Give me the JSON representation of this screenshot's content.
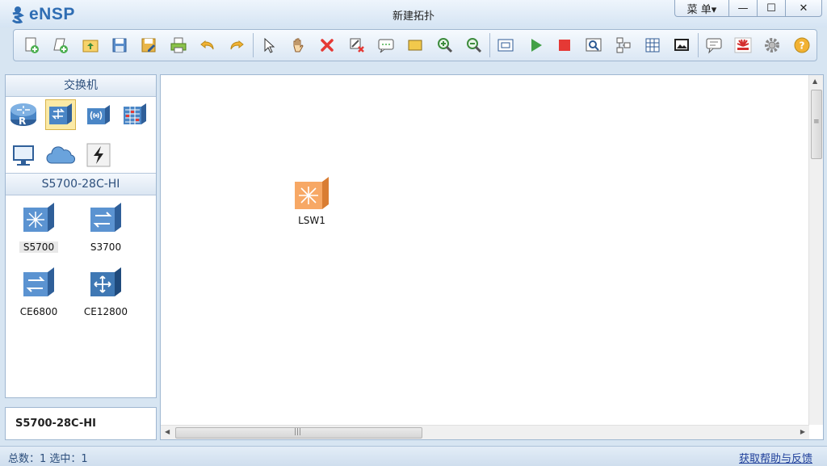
{
  "app": {
    "name": "eNSP",
    "window_title": "新建拓扑"
  },
  "window_controls": {
    "menu_label": "菜 单▾",
    "minimize": "—",
    "maximize": "☐",
    "close": "✕"
  },
  "toolbar": {
    "buttons": [
      {
        "name": "new-topology-icon"
      },
      {
        "name": "new-example-icon"
      },
      {
        "name": "open-icon"
      },
      {
        "name": "save-icon"
      },
      {
        "name": "save-as-icon"
      },
      {
        "name": "print-icon"
      },
      {
        "name": "undo-icon"
      },
      {
        "name": "redo-icon"
      },
      {
        "name": "select-pointer-icon"
      },
      {
        "name": "pan-hand-icon"
      },
      {
        "name": "delete-icon"
      },
      {
        "name": "delete-link-icon"
      },
      {
        "name": "text-note-icon"
      },
      {
        "name": "rectangle-icon"
      },
      {
        "name": "zoom-in-icon"
      },
      {
        "name": "zoom-out-icon"
      },
      {
        "name": "fit-view-icon"
      },
      {
        "name": "start-device-icon"
      },
      {
        "name": "stop-device-icon"
      },
      {
        "name": "capture-icon"
      },
      {
        "name": "topology-icon"
      },
      {
        "name": "grid-icon"
      },
      {
        "name": "screenshot-icon"
      },
      {
        "name": "forum-icon"
      },
      {
        "name": "huawei-icon"
      },
      {
        "name": "settings-gear-icon"
      },
      {
        "name": "help-icon"
      }
    ]
  },
  "left_panel": {
    "category_title": "交换机",
    "categories": [
      {
        "name": "router-category-icon"
      },
      {
        "name": "switch-category-icon",
        "selected": true
      },
      {
        "name": "wlan-category-icon"
      },
      {
        "name": "firewall-category-icon"
      },
      {
        "name": "pc-category-icon"
      },
      {
        "name": "cloud-category-icon"
      },
      {
        "name": "connection-category-icon"
      }
    ],
    "device_group_title": "S5700-28C-HI",
    "devices": [
      {
        "label": "S5700",
        "selected": true
      },
      {
        "label": "S3700"
      },
      {
        "label": "CE6800"
      },
      {
        "label": "CE12800"
      }
    ],
    "info_text": "S5700-28C-HI"
  },
  "canvas": {
    "nodes": [
      {
        "label": "LSW1"
      }
    ]
  },
  "statusbar": {
    "left": "总数：1  选中：1",
    "right": "获取帮助与反馈"
  },
  "colors": {
    "accent": "#2f6db3",
    "switch_node": "#f3a35f",
    "switch_blue": "#3f78b4"
  }
}
